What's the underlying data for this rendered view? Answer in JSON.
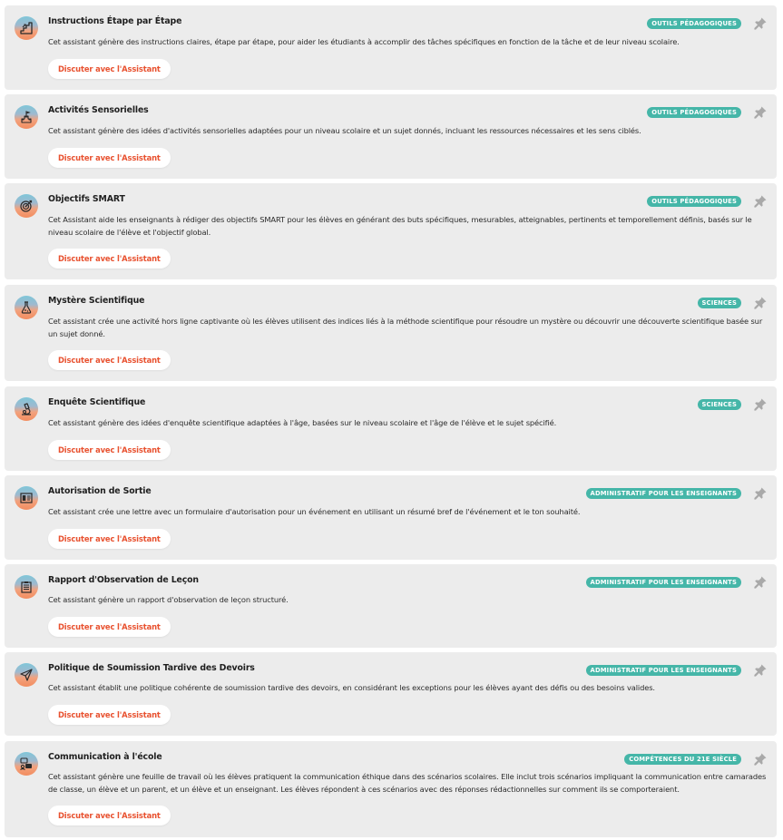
{
  "colors": {
    "card_background": "#ececec",
    "badge_teal": "#45b6a8",
    "button_text_orange": "#e8512f",
    "pin_gray": "#a9a9a9"
  },
  "cards": [
    {
      "title": "Instructions Étape par Étape",
      "description": "Cet assistant génère des instructions claires, étape par étape, pour aider les étudiants à accomplir des tâches spécifiques en fonction de la tâche et de leur niveau scolaire.",
      "badge": "OUTILS PÉDAGOGIQUES",
      "button_label": "Discuter avec l'Assistant",
      "icon": "stairs-icon"
    },
    {
      "title": "Activités Sensorielles",
      "description": "Cet assistant génère des idées d'activités sensorielles adaptées pour un niveau scolaire et un sujet donnés, incluant les ressources nécessaires et les sens ciblés.",
      "badge": "OUTILS PÉDAGOGIQUES",
      "button_label": "Discuter avec l'Assistant",
      "icon": "sand-castle-icon"
    },
    {
      "title": "Objectifs SMART",
      "description": "Cet Assistant aide les enseignants à rédiger des objectifs SMART pour les élèves en générant des buts spécifiques, mesurables, atteignables, pertinents et temporellement définis, basés sur le niveau scolaire de l'élève et l'objectif global.",
      "badge": "OUTILS PÉDAGOGIQUES",
      "button_label": "Discuter avec l'Assistant",
      "icon": "target-icon"
    },
    {
      "title": "Mystère Scientifique",
      "description": "Cet assistant crée une activité hors ligne captivante où les élèves utilisent des indices liés à la méthode scientifique pour résoudre un mystère ou découvrir une découverte scientifique basée sur un sujet donné.",
      "badge": "SCIENCES",
      "button_label": "Discuter avec l'Assistant",
      "icon": "flask-icon"
    },
    {
      "title": "Enquête Scientifique",
      "description": "Cet assistant génère des idées d'enquête scientifique adaptées à l'âge, basées sur le niveau scolaire et l'âge de l'élève et le sujet spécifié.",
      "badge": "SCIENCES",
      "button_label": "Discuter avec l'Assistant",
      "icon": "microscope-icon"
    },
    {
      "title": "Autorisation de Sortie",
      "description": "Cet assistant crée une lettre avec un formulaire d'autorisation pour un événement en utilisant un résumé bref de l'événement et le ton souhaité.",
      "badge": "ADMINISTRATIF POUR LES ENSEIGNANTS",
      "button_label": "Discuter avec l'Assistant",
      "icon": "permission-form-icon"
    },
    {
      "title": "Rapport d'Observation de Leçon",
      "description": "Cet assistant génère un rapport d'observation de leçon structuré.",
      "badge": "ADMINISTRATIF POUR LES ENSEIGNANTS",
      "button_label": "Discuter avec l'Assistant",
      "icon": "report-icon"
    },
    {
      "title": "Politique de Soumission Tardive des Devoirs",
      "description": "Cet assistant établit une politique cohérente de soumission tardive des devoirs, en considérant les exceptions pour les élèves ayant des défis ou des besoins valides.",
      "badge": "ADMINISTRATIF POUR LES ENSEIGNANTS",
      "button_label": "Discuter avec l'Assistant",
      "icon": "paper-plane-icon"
    },
    {
      "title": "Communication à l'école",
      "description": "Cet assistant génère une feuille de travail où les élèves pratiquent la communication éthique dans des scénarios scolaires. Elle inclut trois scénarios impliquant la communication entre camarades de classe, un élève et un parent, et un élève et un enseignant. Les élèves répondent à ces scénarios avec des réponses rédactionnelles sur comment ils se comporteraient.",
      "badge": "COMPÉTENCES DU 21E SIÈCLE",
      "button_label": "Discuter avec l'Assistant",
      "icon": "conversation-icon"
    }
  ]
}
